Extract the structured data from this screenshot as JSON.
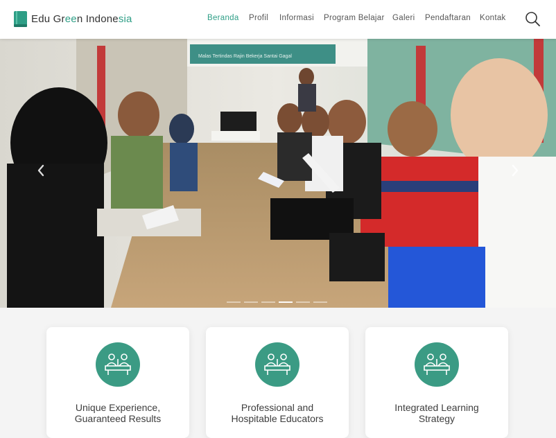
{
  "brand": {
    "part1": "Edu Gr",
    "part2": "ee",
    "part3": "n Indone",
    "part4": "sia"
  },
  "nav": {
    "items": [
      {
        "label": "Beranda",
        "active": true
      },
      {
        "label": "Profil"
      },
      {
        "label": "Informasi"
      },
      {
        "label": "Program Belajar"
      },
      {
        "label": "Galeri"
      },
      {
        "label": "Pendaftaran"
      },
      {
        "label": "Kontak"
      }
    ]
  },
  "hero": {
    "banner_text": "Malas Tertindas    Rajin Bekerja    Santai Gagal",
    "prev_icon": "chevron-left-icon",
    "next_icon": "chevron-right-icon",
    "active_slide": 4,
    "slide_count": 6
  },
  "features": [
    {
      "title": "Unique Experience,\nGuaranteed Results",
      "icon": "classroom-icon"
    },
    {
      "title": "Professional and\nHospitable Educators",
      "icon": "classroom-icon"
    },
    {
      "title": "Integrated Learning\nStrategy",
      "icon": "classroom-icon"
    }
  ],
  "colors": {
    "accent": "#2e9e86",
    "icon_circle": "#3b9b84"
  }
}
